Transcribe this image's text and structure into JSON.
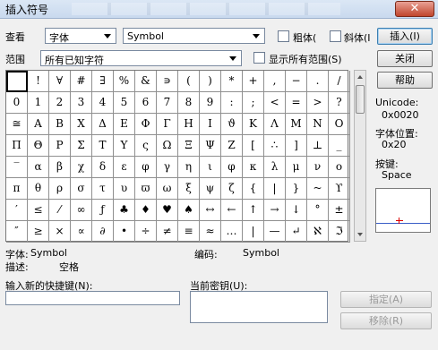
{
  "window": {
    "title": "插入符号",
    "close_glyph": "✕"
  },
  "font_row": {
    "label": "查看",
    "font_type": "字体",
    "font_name": "Symbol",
    "bold_label": "粗体(",
    "italic_label": "斜体(I"
  },
  "range_row": {
    "label": "范围",
    "value": "所有已知字符",
    "show_all_label": "显示所有范围(S)"
  },
  "buttons": {
    "insert": "插入(I)",
    "close": "关闭",
    "help": "帮助",
    "assign": "指定(A)",
    "remove": "移除(R)"
  },
  "info": {
    "unicode_label": "Unicode:",
    "unicode_value": "0x0020",
    "font_pos_label": "字体位置:",
    "font_pos_value": "0x20",
    "key_label": "按键:",
    "key_value": "Space"
  },
  "footer": {
    "font_label": "字体:",
    "font_value": "Symbol",
    "encoding_label": "编码:",
    "encoding_value": "Symbol",
    "desc_label": "描述:",
    "desc_value": "空格",
    "new_shortcut_label": "输入新的快捷键(N):",
    "current_keys_label": "当前密钥(U):"
  },
  "grid": {
    "rows": [
      [
        "",
        "!",
        "∀",
        "#",
        "∃",
        "%",
        "&",
        "∍",
        "(",
        ")",
        "*",
        "+",
        ",",
        "−",
        ".",
        "/"
      ],
      [
        "0",
        "1",
        "2",
        "3",
        "4",
        "5",
        "6",
        "7",
        "8",
        "9",
        ":",
        ";",
        "<",
        "=",
        ">",
        "?"
      ],
      [
        "≅",
        "Α",
        "Β",
        "Χ",
        "Δ",
        "Ε",
        "Φ",
        "Γ",
        "Η",
        "Ι",
        "ϑ",
        "Κ",
        "Λ",
        "Μ",
        "Ν",
        "Ο"
      ],
      [
        "Π",
        "Θ",
        "Ρ",
        "Σ",
        "Τ",
        "Υ",
        "ς",
        "Ω",
        "Ξ",
        "Ψ",
        "Ζ",
        "[",
        "∴",
        "]",
        "⊥",
        "_"
      ],
      [
        "‾",
        "α",
        "β",
        "χ",
        "δ",
        "ε",
        "φ",
        "γ",
        "η",
        "ι",
        "φ",
        "κ",
        "λ",
        "μ",
        "ν",
        "ο"
      ],
      [
        "π",
        "θ",
        "ρ",
        "σ",
        "τ",
        "υ",
        "ϖ",
        "ω",
        "ξ",
        "ψ",
        "ζ",
        "{",
        "|",
        "}",
        "~",
        "ϒ"
      ],
      [
        "′",
        "≤",
        "⁄",
        "∞",
        "ƒ",
        "♣",
        "♦",
        "♥",
        "♠",
        "↔",
        "←",
        "↑",
        "→",
        "↓",
        "°",
        "±"
      ],
      [
        "″",
        "≥",
        "×",
        "∝",
        "∂",
        "•",
        "÷",
        "≠",
        "≡",
        "≈",
        "…",
        "|",
        "—",
        "↵",
        "ℵ",
        "ℑ"
      ]
    ]
  }
}
